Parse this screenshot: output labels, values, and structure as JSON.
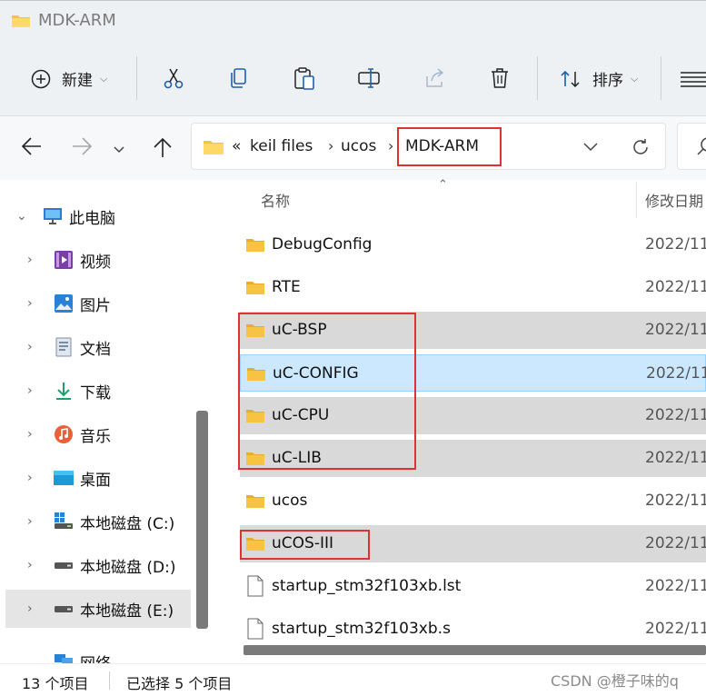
{
  "window": {
    "title": "MDK-ARM"
  },
  "toolbar": {
    "new_label": "新建",
    "sort_label": "排序"
  },
  "address": {
    "prefix": "«",
    "crumbs": [
      "keil files",
      "ucos",
      "MDK-ARM"
    ]
  },
  "columns": {
    "name": "名称",
    "modified": "修改日期"
  },
  "sidebar": {
    "items": [
      {
        "label": "此电脑",
        "icon": "pc-icon"
      },
      {
        "label": "视频",
        "icon": "video-icon"
      },
      {
        "label": "图片",
        "icon": "pictures-icon"
      },
      {
        "label": "文档",
        "icon": "documents-icon"
      },
      {
        "label": "下载",
        "icon": "download-icon"
      },
      {
        "label": "音乐",
        "icon": "music-icon"
      },
      {
        "label": "桌面",
        "icon": "desktop-icon"
      },
      {
        "label": "本地磁盘 (C:)",
        "icon": "drive-c-icon"
      },
      {
        "label": "本地磁盘 (D:)",
        "icon": "drive-icon"
      },
      {
        "label": "本地磁盘 (E:)",
        "icon": "drive-icon"
      },
      {
        "label": "网络",
        "icon": "network-icon"
      }
    ]
  },
  "files": [
    {
      "name": "DebugConfig",
      "date": "2022/11",
      "type": "folder",
      "state": "none"
    },
    {
      "name": "RTE",
      "date": "2022/11",
      "type": "folder",
      "state": "none"
    },
    {
      "name": "uC-BSP",
      "date": "2022/11",
      "type": "folder",
      "state": "selected"
    },
    {
      "name": "uC-CONFIG",
      "date": "2022/11",
      "type": "folder",
      "state": "focused"
    },
    {
      "name": "uC-CPU",
      "date": "2022/11",
      "type": "folder",
      "state": "selected"
    },
    {
      "name": "uC-LIB",
      "date": "2022/11",
      "type": "folder",
      "state": "selected"
    },
    {
      "name": "ucos",
      "date": "2022/11",
      "type": "folder",
      "state": "none"
    },
    {
      "name": "uCOS-III",
      "date": "2022/11",
      "type": "folder",
      "state": "selected"
    },
    {
      "name": "startup_stm32f103xb.lst",
      "date": "2022/11",
      "type": "file",
      "state": "none"
    },
    {
      "name": "startup_stm32f103xb.s",
      "date": "2022/11",
      "type": "file",
      "state": "none"
    }
  ],
  "status": {
    "count": "13 个项目",
    "selected": "已选择 5 个项目"
  },
  "watermark": "CSDN @橙子味的q",
  "colors": {
    "highlight_box": "#e03131",
    "folder": "#f6c343",
    "selection": "#d9d9d9",
    "focus": "#cce8ff"
  }
}
